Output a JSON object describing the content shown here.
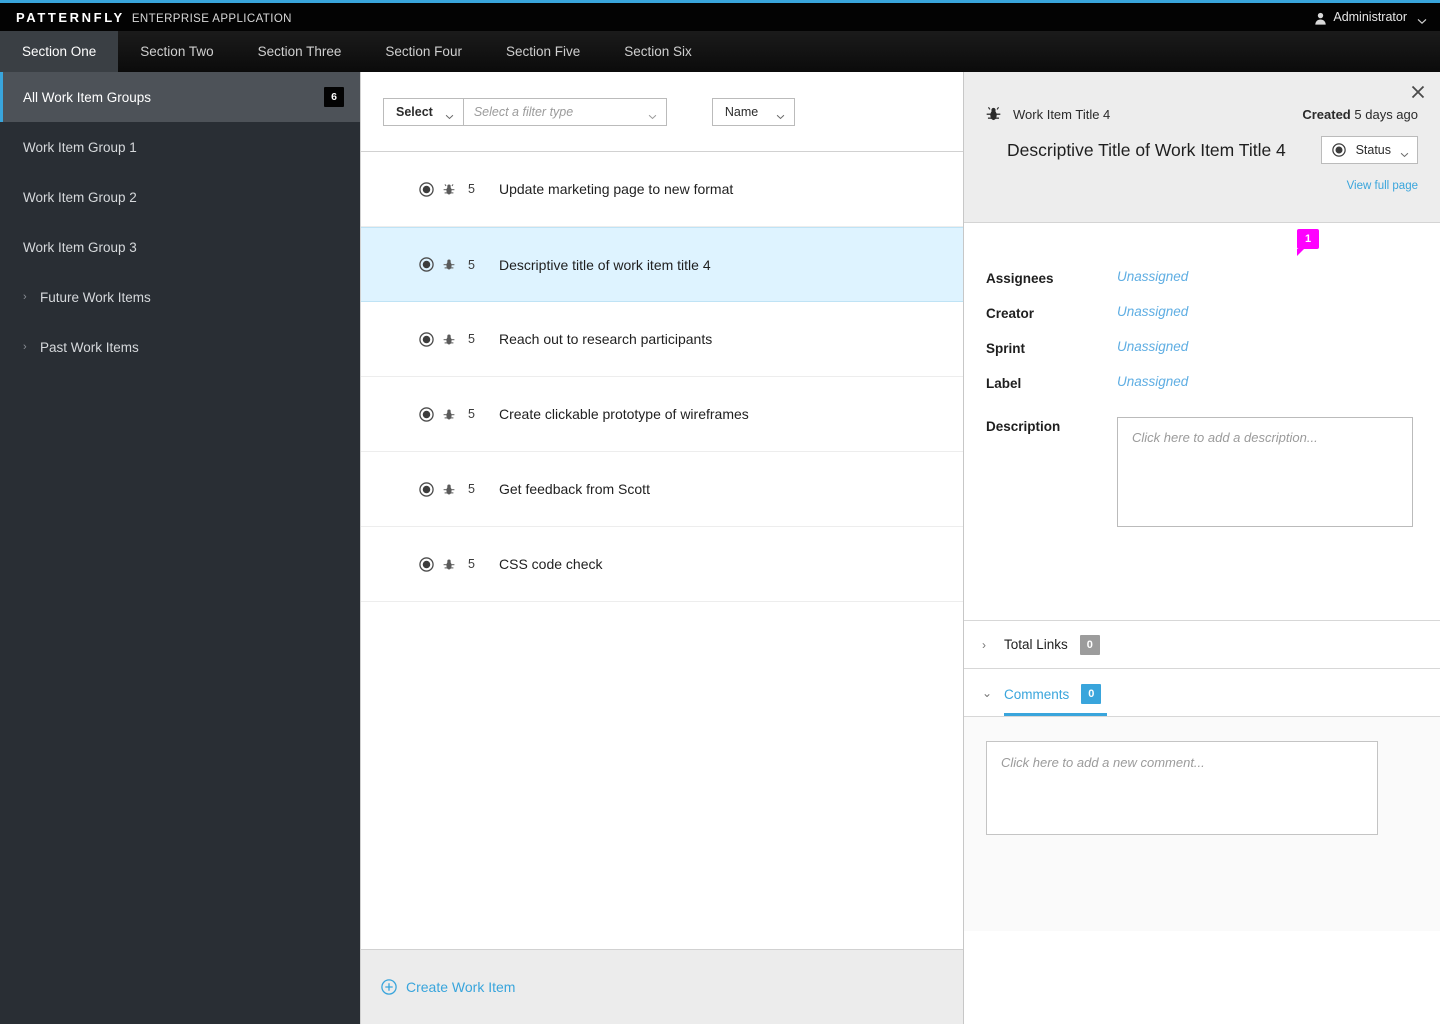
{
  "brand": {
    "name": "PATTERNFLY",
    "subtitle": "ENTERPRISE APPLICATION"
  },
  "user": {
    "name": "Administrator",
    "icon": "user-icon",
    "caret": "chevron-down-icon"
  },
  "tabs": [
    {
      "label": "Section One",
      "active": true
    },
    {
      "label": "Section Two",
      "active": false
    },
    {
      "label": "Section Three",
      "active": false
    },
    {
      "label": "Section Four",
      "active": false
    },
    {
      "label": "Section Five",
      "active": false
    },
    {
      "label": "Section Six",
      "active": false
    }
  ],
  "sidebar": {
    "items": [
      {
        "label": "All Work Item Groups",
        "badge": "6",
        "active": true,
        "expandable": false
      },
      {
        "label": "Work Item Group 1",
        "active": false,
        "expandable": false
      },
      {
        "label": "Work Item Group 2",
        "active": false,
        "expandable": false
      },
      {
        "label": "Work Item Group 3",
        "active": false,
        "expandable": false
      },
      {
        "label": "Future Work Items",
        "active": false,
        "expandable": true,
        "chevron": "›"
      },
      {
        "label": "Past Work Items",
        "active": false,
        "expandable": true,
        "chevron": "›"
      }
    ]
  },
  "toolbar": {
    "select_label": "Select",
    "filter_placeholder": "Select a filter type",
    "sort_label": "Name"
  },
  "list": {
    "rows": [
      {
        "count": "5",
        "title": "Update marketing page to new format",
        "selected": false
      },
      {
        "count": "5",
        "title": "Descriptive title of work item title 4",
        "selected": true
      },
      {
        "count": "5",
        "title": "Reach out to research participants",
        "selected": false
      },
      {
        "count": "5",
        "title": "Create clickable prototype of wireframes",
        "selected": false
      },
      {
        "count": "5",
        "title": "Get feedback from Scott",
        "selected": false
      },
      {
        "count": "5",
        "title": "CSS code check",
        "selected": false
      }
    ]
  },
  "footer": {
    "create_label": "Create Work Item",
    "icon": "plus-circle-icon"
  },
  "panel": {
    "close_icon": "close-icon",
    "type_icon": "bug-icon",
    "item_type": "Work Item Title 4",
    "created_prefix": "Created",
    "created_value": "5 days ago",
    "title": "Descriptive Title of Work Item Title 4",
    "status_label": "Status",
    "view_full_page": "View full page",
    "notification_badge": "1",
    "fields": [
      {
        "label": "Assignees",
        "value": "Unassigned"
      },
      {
        "label": "Creator",
        "value": "Unassigned"
      },
      {
        "label": "Sprint",
        "value": "Unassigned"
      },
      {
        "label": "Label",
        "value": "Unassigned"
      }
    ],
    "description_label": "Description",
    "description_placeholder": "Click here to add a description...",
    "total_links": {
      "label": "Total Links",
      "count": "0",
      "chevron": "›"
    },
    "comments": {
      "label": "Comments",
      "count": "0",
      "chevron": "⌄"
    },
    "comment_placeholder": "Click here to add a new comment..."
  },
  "colors": {
    "accent": "#39a5dc",
    "sidebar_bg": "#292e34",
    "sidebar_active": "#4d5258",
    "selected_row": "#def3ff",
    "badge_magenta": "#ff00ff",
    "panel_head": "#ededed"
  }
}
